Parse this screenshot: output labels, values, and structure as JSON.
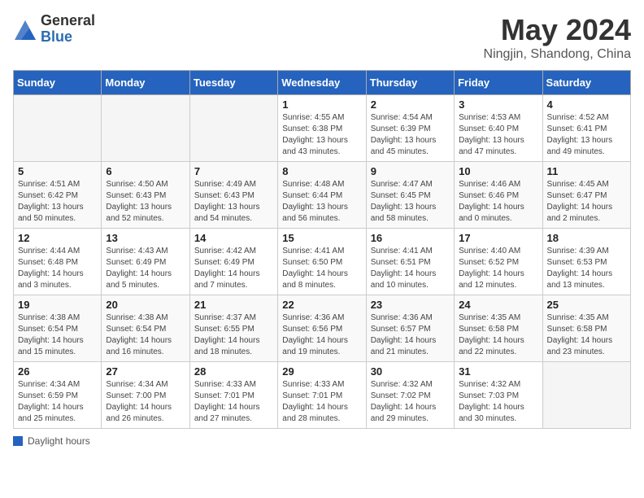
{
  "header": {
    "logo_general": "General",
    "logo_blue": "Blue",
    "month_title": "May 2024",
    "location": "Ningjin, Shandong, China"
  },
  "days_of_week": [
    "Sunday",
    "Monday",
    "Tuesday",
    "Wednesday",
    "Thursday",
    "Friday",
    "Saturday"
  ],
  "footer_label": "Daylight hours",
  "weeks": [
    [
      {
        "day": "",
        "sunrise": "",
        "sunset": "",
        "daylight": ""
      },
      {
        "day": "",
        "sunrise": "",
        "sunset": "",
        "daylight": ""
      },
      {
        "day": "",
        "sunrise": "",
        "sunset": "",
        "daylight": ""
      },
      {
        "day": "1",
        "sunrise": "Sunrise: 4:55 AM",
        "sunset": "Sunset: 6:38 PM",
        "daylight": "Daylight: 13 hours and 43 minutes."
      },
      {
        "day": "2",
        "sunrise": "Sunrise: 4:54 AM",
        "sunset": "Sunset: 6:39 PM",
        "daylight": "Daylight: 13 hours and 45 minutes."
      },
      {
        "day": "3",
        "sunrise": "Sunrise: 4:53 AM",
        "sunset": "Sunset: 6:40 PM",
        "daylight": "Daylight: 13 hours and 47 minutes."
      },
      {
        "day": "4",
        "sunrise": "Sunrise: 4:52 AM",
        "sunset": "Sunset: 6:41 PM",
        "daylight": "Daylight: 13 hours and 49 minutes."
      }
    ],
    [
      {
        "day": "5",
        "sunrise": "Sunrise: 4:51 AM",
        "sunset": "Sunset: 6:42 PM",
        "daylight": "Daylight: 13 hours and 50 minutes."
      },
      {
        "day": "6",
        "sunrise": "Sunrise: 4:50 AM",
        "sunset": "Sunset: 6:43 PM",
        "daylight": "Daylight: 13 hours and 52 minutes."
      },
      {
        "day": "7",
        "sunrise": "Sunrise: 4:49 AM",
        "sunset": "Sunset: 6:43 PM",
        "daylight": "Daylight: 13 hours and 54 minutes."
      },
      {
        "day": "8",
        "sunrise": "Sunrise: 4:48 AM",
        "sunset": "Sunset: 6:44 PM",
        "daylight": "Daylight: 13 hours and 56 minutes."
      },
      {
        "day": "9",
        "sunrise": "Sunrise: 4:47 AM",
        "sunset": "Sunset: 6:45 PM",
        "daylight": "Daylight: 13 hours and 58 minutes."
      },
      {
        "day": "10",
        "sunrise": "Sunrise: 4:46 AM",
        "sunset": "Sunset: 6:46 PM",
        "daylight": "Daylight: 14 hours and 0 minutes."
      },
      {
        "day": "11",
        "sunrise": "Sunrise: 4:45 AM",
        "sunset": "Sunset: 6:47 PM",
        "daylight": "Daylight: 14 hours and 2 minutes."
      }
    ],
    [
      {
        "day": "12",
        "sunrise": "Sunrise: 4:44 AM",
        "sunset": "Sunset: 6:48 PM",
        "daylight": "Daylight: 14 hours and 3 minutes."
      },
      {
        "day": "13",
        "sunrise": "Sunrise: 4:43 AM",
        "sunset": "Sunset: 6:49 PM",
        "daylight": "Daylight: 14 hours and 5 minutes."
      },
      {
        "day": "14",
        "sunrise": "Sunrise: 4:42 AM",
        "sunset": "Sunset: 6:49 PM",
        "daylight": "Daylight: 14 hours and 7 minutes."
      },
      {
        "day": "15",
        "sunrise": "Sunrise: 4:41 AM",
        "sunset": "Sunset: 6:50 PM",
        "daylight": "Daylight: 14 hours and 8 minutes."
      },
      {
        "day": "16",
        "sunrise": "Sunrise: 4:41 AM",
        "sunset": "Sunset: 6:51 PM",
        "daylight": "Daylight: 14 hours and 10 minutes."
      },
      {
        "day": "17",
        "sunrise": "Sunrise: 4:40 AM",
        "sunset": "Sunset: 6:52 PM",
        "daylight": "Daylight: 14 hours and 12 minutes."
      },
      {
        "day": "18",
        "sunrise": "Sunrise: 4:39 AM",
        "sunset": "Sunset: 6:53 PM",
        "daylight": "Daylight: 14 hours and 13 minutes."
      }
    ],
    [
      {
        "day": "19",
        "sunrise": "Sunrise: 4:38 AM",
        "sunset": "Sunset: 6:54 PM",
        "daylight": "Daylight: 14 hours and 15 minutes."
      },
      {
        "day": "20",
        "sunrise": "Sunrise: 4:38 AM",
        "sunset": "Sunset: 6:54 PM",
        "daylight": "Daylight: 14 hours and 16 minutes."
      },
      {
        "day": "21",
        "sunrise": "Sunrise: 4:37 AM",
        "sunset": "Sunset: 6:55 PM",
        "daylight": "Daylight: 14 hours and 18 minutes."
      },
      {
        "day": "22",
        "sunrise": "Sunrise: 4:36 AM",
        "sunset": "Sunset: 6:56 PM",
        "daylight": "Daylight: 14 hours and 19 minutes."
      },
      {
        "day": "23",
        "sunrise": "Sunrise: 4:36 AM",
        "sunset": "Sunset: 6:57 PM",
        "daylight": "Daylight: 14 hours and 21 minutes."
      },
      {
        "day": "24",
        "sunrise": "Sunrise: 4:35 AM",
        "sunset": "Sunset: 6:58 PM",
        "daylight": "Daylight: 14 hours and 22 minutes."
      },
      {
        "day": "25",
        "sunrise": "Sunrise: 4:35 AM",
        "sunset": "Sunset: 6:58 PM",
        "daylight": "Daylight: 14 hours and 23 minutes."
      }
    ],
    [
      {
        "day": "26",
        "sunrise": "Sunrise: 4:34 AM",
        "sunset": "Sunset: 6:59 PM",
        "daylight": "Daylight: 14 hours and 25 minutes."
      },
      {
        "day": "27",
        "sunrise": "Sunrise: 4:34 AM",
        "sunset": "Sunset: 7:00 PM",
        "daylight": "Daylight: 14 hours and 26 minutes."
      },
      {
        "day": "28",
        "sunrise": "Sunrise: 4:33 AM",
        "sunset": "Sunset: 7:01 PM",
        "daylight": "Daylight: 14 hours and 27 minutes."
      },
      {
        "day": "29",
        "sunrise": "Sunrise: 4:33 AM",
        "sunset": "Sunset: 7:01 PM",
        "daylight": "Daylight: 14 hours and 28 minutes."
      },
      {
        "day": "30",
        "sunrise": "Sunrise: 4:32 AM",
        "sunset": "Sunset: 7:02 PM",
        "daylight": "Daylight: 14 hours and 29 minutes."
      },
      {
        "day": "31",
        "sunrise": "Sunrise: 4:32 AM",
        "sunset": "Sunset: 7:03 PM",
        "daylight": "Daylight: 14 hours and 30 minutes."
      },
      {
        "day": "",
        "sunrise": "",
        "sunset": "",
        "daylight": ""
      }
    ]
  ]
}
